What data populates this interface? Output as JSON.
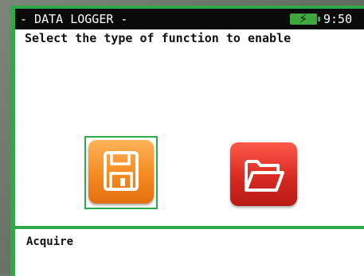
{
  "titlebar": {
    "title": "- DATA LOGGER -",
    "time": "9:50",
    "battery_icon": "battery-charging-icon"
  },
  "prompt": "Select the type of function to enable",
  "functions": [
    {
      "icon": "floppy-disk-icon",
      "selected": true,
      "color": "#f58a1f"
    },
    {
      "icon": "open-folder-icon",
      "selected": false,
      "color": "#d82a22"
    }
  ],
  "status": "Acquire",
  "colors": {
    "accent": "#2fa84a",
    "titlebar_bg": "#0a0a0a"
  }
}
